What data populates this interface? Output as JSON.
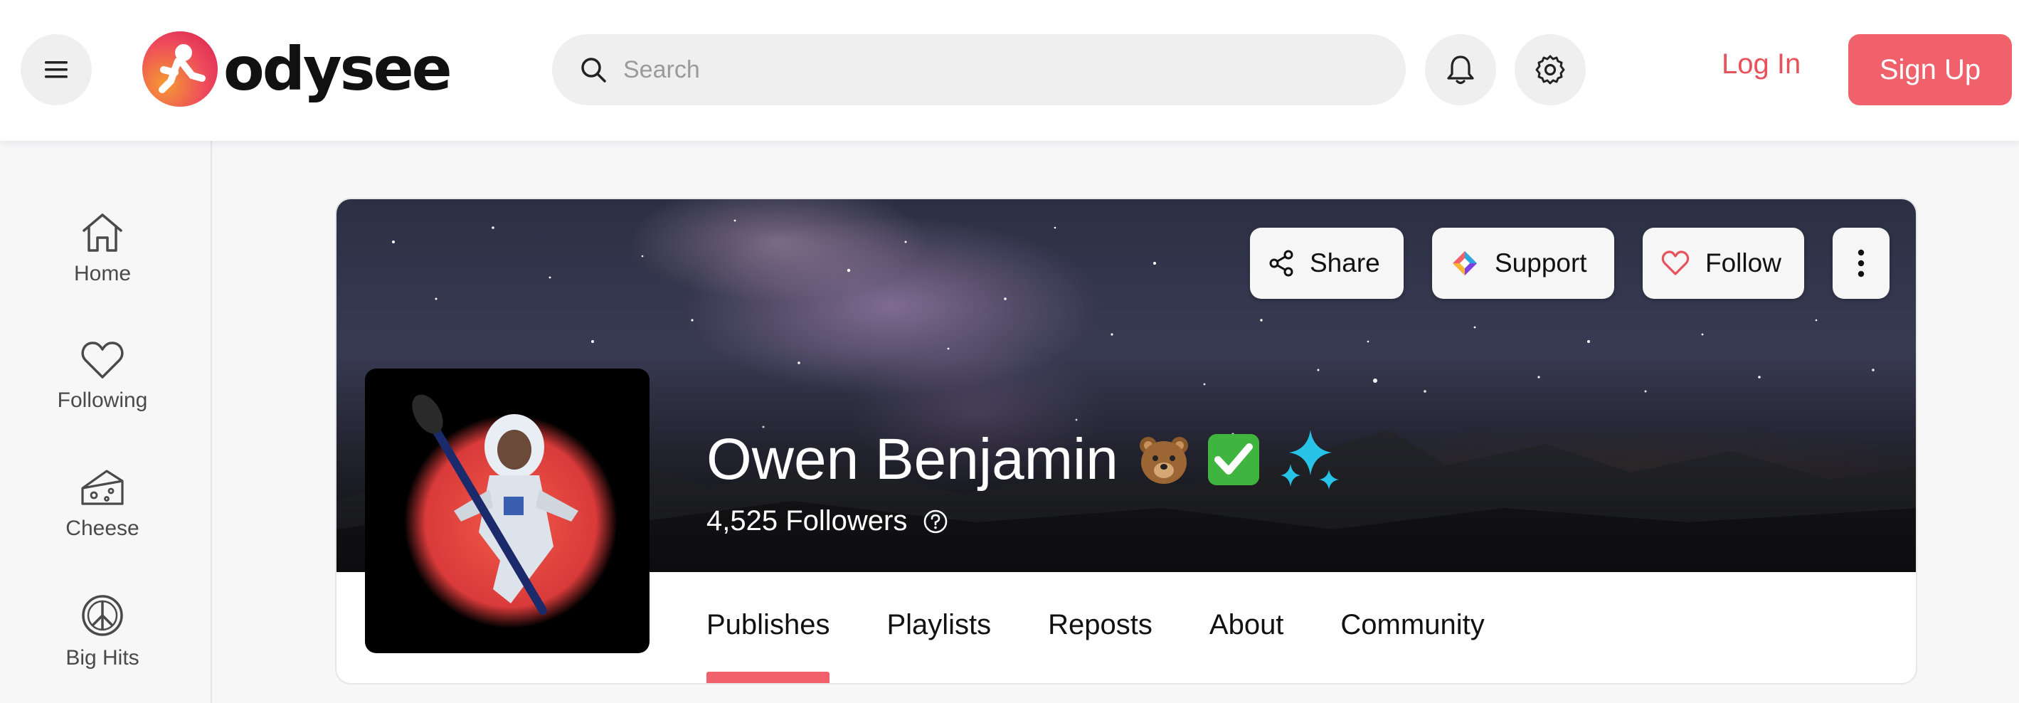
{
  "header": {
    "logo_text": "odysee",
    "search_placeholder": "Search",
    "login_label": "Log In",
    "signup_label": "Sign Up"
  },
  "sidebar": {
    "items": [
      {
        "label": "Home",
        "icon": "home-icon"
      },
      {
        "label": "Following",
        "icon": "heart-icon"
      },
      {
        "label": "Cheese",
        "icon": "cheese-icon"
      },
      {
        "label": "Big Hits",
        "icon": "peace-icon"
      }
    ]
  },
  "channel": {
    "name": "Owen Benjamin",
    "emojis": [
      "🐻",
      "✅",
      "✨"
    ],
    "followers": "4,525 Followers",
    "actions": {
      "share": "Share",
      "support": "Support",
      "follow": "Follow"
    },
    "tabs": [
      "Publishes",
      "Playlists",
      "Reposts",
      "About",
      "Community"
    ],
    "active_tab": "Publishes"
  },
  "colors": {
    "accent": "#f1616b",
    "header_bg": "#ffffff",
    "sidebar_bg": "#f7f7f8"
  }
}
